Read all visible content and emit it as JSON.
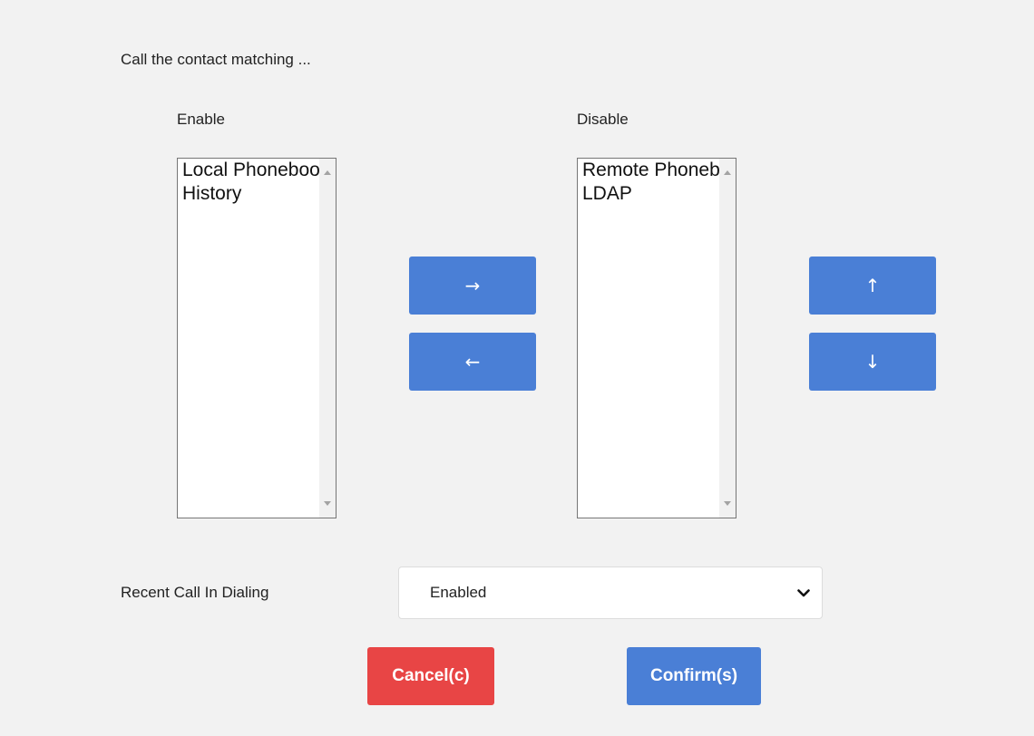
{
  "heading": "Call the contact matching ...",
  "enable_list": {
    "label": "Enable",
    "items": [
      "Local Phonebook",
      "History"
    ]
  },
  "disable_list": {
    "label": "Disable",
    "items": [
      "Remote Phonebook",
      "LDAP"
    ]
  },
  "transfer_buttons": {
    "move_right": "→",
    "move_left": "←"
  },
  "order_buttons": {
    "move_up": "↑",
    "move_down": "↓"
  },
  "recent_call": {
    "label": "Recent Call In Dialing",
    "selected": "Enabled"
  },
  "actions": {
    "cancel": "Cancel(c)",
    "confirm": "Confirm(s)"
  },
  "colors": {
    "panel_bg": "#f2f2f2",
    "primary_blue": "#4a7fd6",
    "danger_red": "#e84545"
  },
  "icons": {
    "select_arrow": "chevron-down-icon",
    "scroll_up": "scroll-up-arrow-icon",
    "scroll_down": "scroll-down-arrow-icon"
  }
}
